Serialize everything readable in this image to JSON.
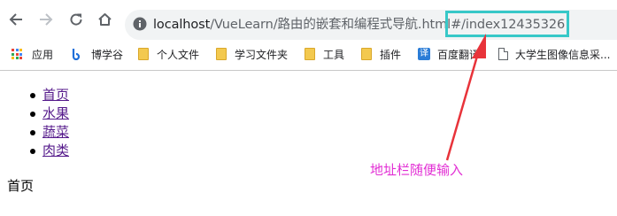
{
  "browser": {
    "url_host": "localhost",
    "url_path": "/VueLearn/路由的嵌套和编程式导航.html#/index12435326",
    "icons": {
      "back": "arrow-left-icon",
      "forward": "arrow-right-icon",
      "reload": "reload-icon",
      "home": "home-icon",
      "site_info": "info-icon"
    }
  },
  "bookmarks": [
    {
      "label": "应用",
      "icon": "apps-grid-icon"
    },
    {
      "label": "博学谷",
      "icon": "site-favicon-icon"
    },
    {
      "label": "个人文件",
      "icon": "folder-icon"
    },
    {
      "label": "学习文件夹",
      "icon": "folder-icon"
    },
    {
      "label": "工具",
      "icon": "folder-icon"
    },
    {
      "label": "插件",
      "icon": "folder-icon"
    },
    {
      "label": "百度翻译",
      "icon": "translate-icon"
    },
    {
      "label": "大学生图像信息采...",
      "icon": "page-icon"
    }
  ],
  "page": {
    "nav_links": [
      "首页",
      "水果",
      "蔬菜",
      "肉类"
    ],
    "view_text": "首页"
  },
  "annotation": {
    "text": "地址栏随便输入",
    "color": "#e22fd4",
    "box_color": "#37c8c8",
    "arrow_color": "#e8333a"
  }
}
